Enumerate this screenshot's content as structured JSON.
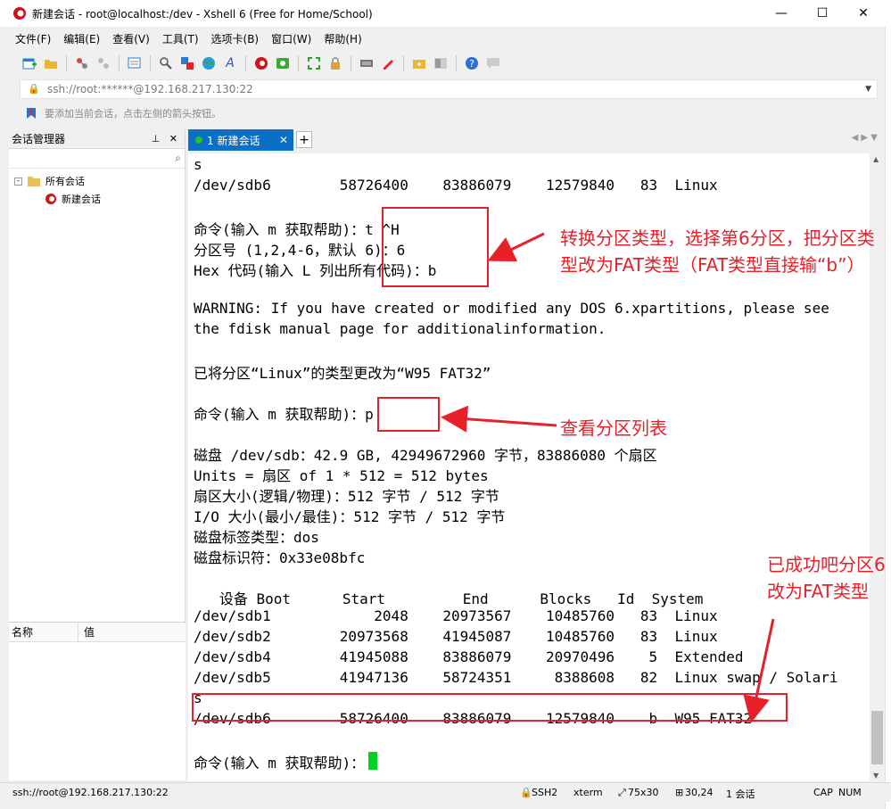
{
  "window": {
    "title": "新建会话 - root@localhost:/dev - Xshell 6 (Free for Home/School)",
    "controls": {
      "minimize": "—",
      "maximize": "☐",
      "close": "✕"
    }
  },
  "menu": [
    "文件(F)",
    "编辑(E)",
    "查看(V)",
    "工具(T)",
    "选项卡(B)",
    "窗口(W)",
    "帮助(H)"
  ],
  "toolbar_icons": [
    "new-session-icon",
    "open-folder-icon",
    "connect-icon",
    "disconnect-icon",
    "properties-icon",
    "find-icon",
    "transfer-icon",
    "globe-icon",
    "font-icon",
    "xshell-icon",
    "xftp-icon",
    "fullscreen-icon",
    "lock-icon",
    "keyboard-icon",
    "compose-icon",
    "new-tab-icon",
    "layout-icon",
    "help-icon",
    "chat-icon"
  ],
  "address_bar": {
    "value": "ssh://root:******@192.168.217.130:22"
  },
  "hint_bar": {
    "text": "要添加当前会话，点击左侧的箭头按钮。"
  },
  "session_manager": {
    "title": "会话管理器",
    "tree": [
      {
        "label": "所有会话",
        "type": "folder"
      },
      {
        "label": "新建会话",
        "type": "session"
      }
    ],
    "properties": {
      "col_name": "名称",
      "col_value": "值"
    }
  },
  "tabs": [
    {
      "label": "1 新建会话",
      "active": true
    }
  ],
  "terminal_lines": [
    "s",
    "/dev/sdb6        58726400    83886079    12579840   83  Linux",
    "",
    "命令(输入 m 获取帮助)：t ^H",
    "分区号 (1,2,4-6，默认 6)：6",
    "Hex 代码(输入 L 列出所有代码)：b",
    "",
    "WARNING: If you have created or modified any DOS 6.xpartitions, please see",
    "the fdisk manual page for additionalinformation.",
    "",
    "已将分区“Linux”的类型更改为“W95 FAT32”",
    "",
    "命令(输入 m 获取帮助)：p",
    "",
    "磁盘 /dev/sdb：42.9 GB, 42949672960 字节，83886080 个扇区",
    "Units = 扇区 of 1 * 512 = 512 bytes",
    "扇区大小(逻辑/物理)：512 字节 / 512 字节",
    "I/O 大小(最小/最佳)：512 字节 / 512 字节",
    "磁盘标签类型：dos",
    "磁盘标识符：0x33e08bfc",
    "",
    "   设备 Boot      Start         End      Blocks   Id  System",
    "/dev/sdb1            2048    20973567    10485760   83  Linux",
    "/dev/sdb2        20973568    41945087    10485760   83  Linux",
    "/dev/sdb4        41945088    83886079    20970496    5  Extended",
    "/dev/sdb5        41947136    58724351     8388608   82  Linux swap / Solari",
    "s",
    "/dev/sdb6        58726400    83886079    12579840    b  W95 FAT32",
    "",
    "命令(输入 m 获取帮助)："
  ],
  "annotations": [
    "转换分区类型，选择第6分区，把分区类型改为FAT类型（FAT类型直接输“b”）",
    "查看分区列表",
    "已成功吧分区6 改为FAT类型"
  ],
  "status_bar": {
    "connection": "ssh://root@192.168.217.130:22",
    "protocol": "SSH2",
    "terminal": "xterm",
    "size": "75x30",
    "cursor_pos": "30,24",
    "sessions": "1 会话",
    "caps": "CAP",
    "num": "NUM"
  },
  "colors": {
    "tab_active": "#0b6fc5",
    "annotation": "#e8202a",
    "cursor": "#00d41e"
  }
}
